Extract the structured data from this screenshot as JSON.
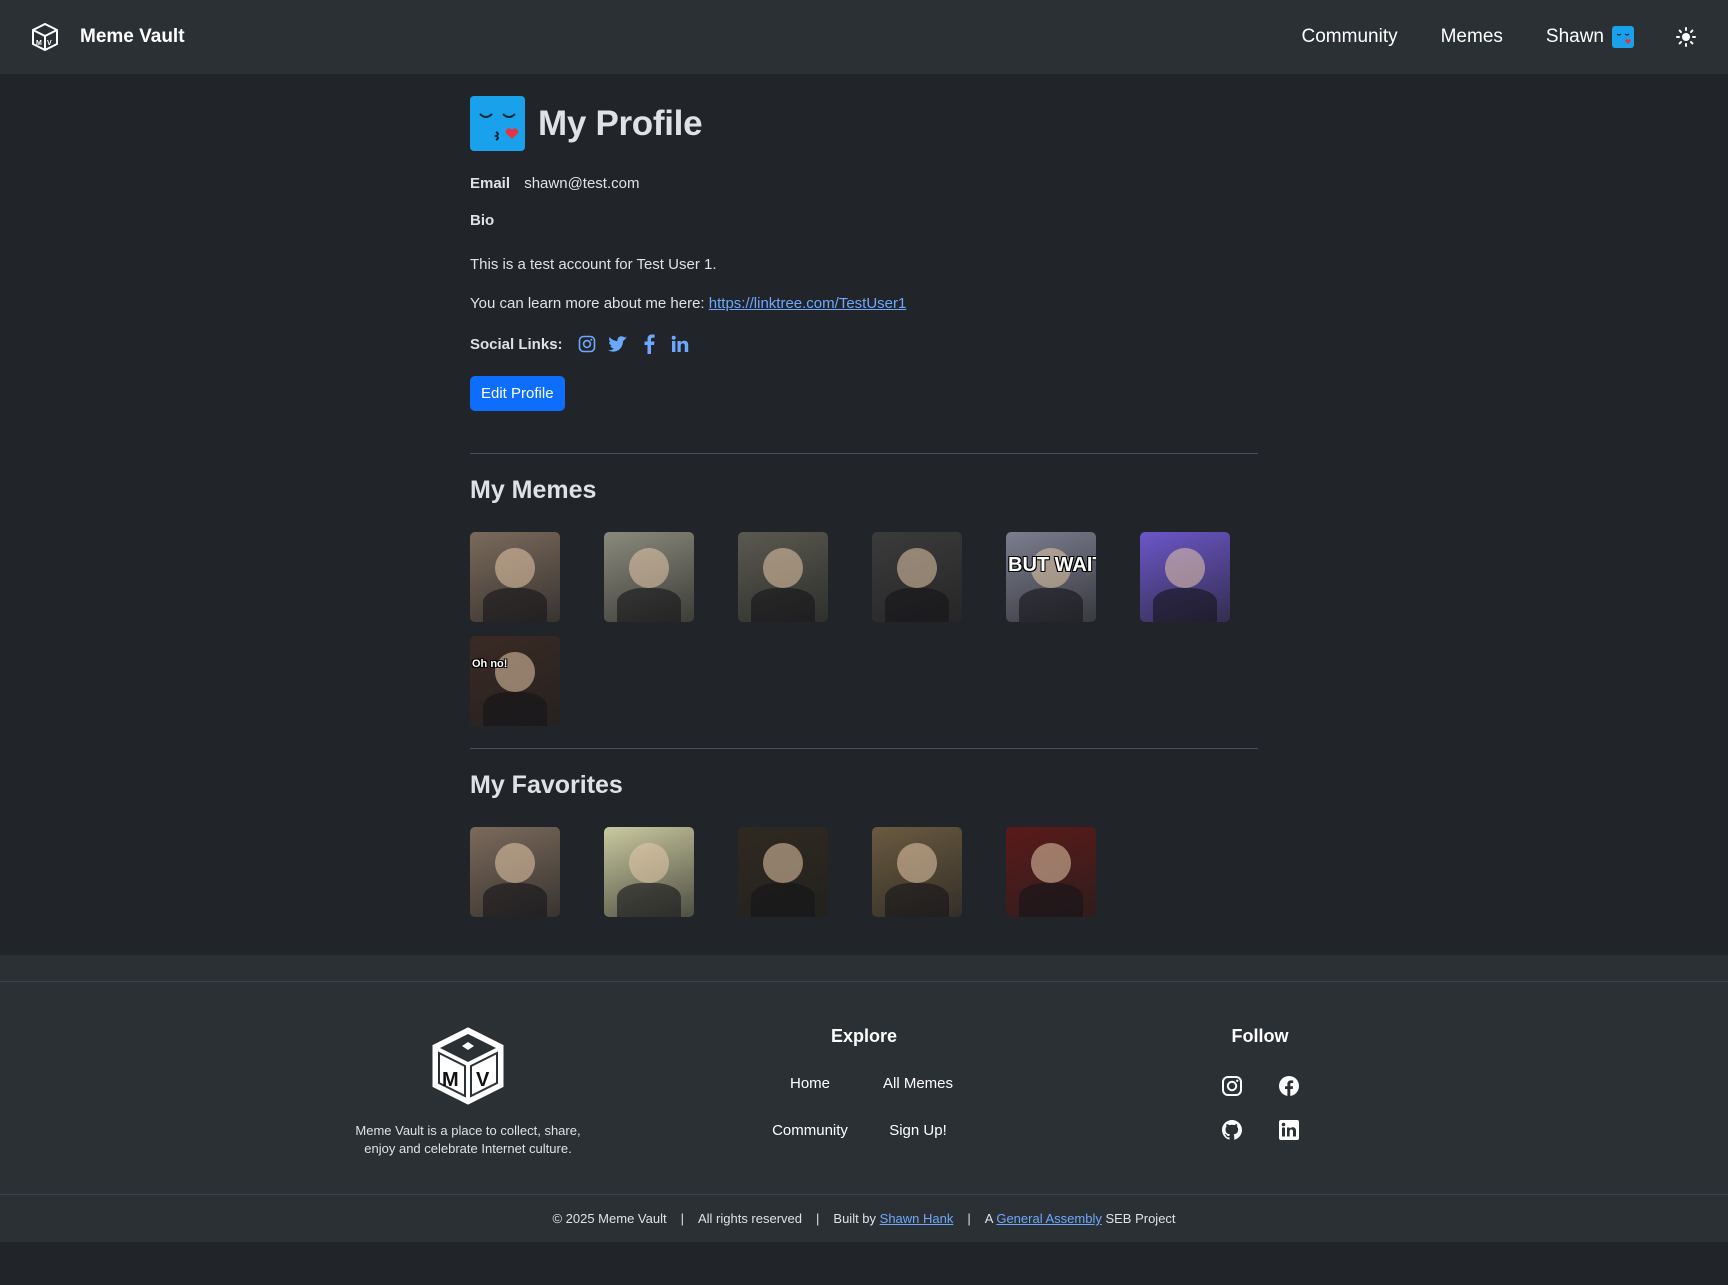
{
  "nav": {
    "brand": "Meme Vault",
    "links": [
      "Community",
      "Memes"
    ],
    "user": "Shawn",
    "icons": {
      "logo": "mv-cube-logo",
      "avatar": "kissing-face-avatar",
      "theme": "sun-icon"
    }
  },
  "profile": {
    "title": "My Profile",
    "email_label": "Email",
    "email": "shawn@test.com",
    "bio_label": "Bio",
    "bio_line1": "This is a test account for Test User 1.",
    "bio_line2_prefix": "You can learn more about me here: ",
    "bio_link": "https://linktree.com/TestUser1",
    "social_label": "Social Links:",
    "social_icons": [
      "instagram-icon",
      "twitter-icon",
      "facebook-icon",
      "linkedin-icon"
    ],
    "edit_button": "Edit Profile"
  },
  "my_memes": {
    "title": "My Memes",
    "items": [
      {
        "name": "rick-astley",
        "bg": "#7b6a5c"
      },
      {
        "name": "pole-cam",
        "bg": "#8a8a7c"
      },
      {
        "name": "dancing-man",
        "bg": "#5a5a50"
      },
      {
        "name": "bw-crowd",
        "bg": "#3b3b3b"
      },
      {
        "name": "but-wait",
        "bg": "#7c7e90",
        "caption": "BUT WAIT,"
      },
      {
        "name": "success-kid",
        "bg": "#6b56c9"
      },
      {
        "name": "oh-no",
        "bg": "#3a2a24",
        "caption": "Oh no!"
      }
    ]
  },
  "my_favorites": {
    "title": "My Favorites",
    "items": [
      {
        "name": "rick-astley",
        "bg": "#7b6a5c"
      },
      {
        "name": "this-is-fine",
        "bg": "#c9c9a0"
      },
      {
        "name": "snoop-dog",
        "bg": "#2f2a20"
      },
      {
        "name": "obama-mic-drop",
        "bg": "#6a5a40"
      },
      {
        "name": "muppet-hecklers",
        "bg": "#5b1a1a"
      }
    ]
  },
  "footer": {
    "description": "Meme Vault is a place to collect, share, enjoy and celebrate Internet culture.",
    "explore_heading": "Explore",
    "explore_links": [
      "Home",
      "All Memes",
      "Community",
      "Sign Up!"
    ],
    "follow_heading": "Follow",
    "follow_icons": [
      "instagram-icon",
      "facebook-icon",
      "github-icon",
      "linkedin-icon"
    ],
    "copyright": "© 2025 Meme Vault",
    "rights": "All rights reserved",
    "built_by_prefix": "Built by ",
    "built_by_name": "Shawn Hank",
    "project_prefix": "A ",
    "project_link": "General Assembly",
    "project_suffix": " SEB Project",
    "separator": "|"
  },
  "colors": {
    "page_bg": "#212529",
    "nav_bg": "#2b3035",
    "accent": "#0d6efd",
    "link": "#6ea8fe",
    "avatar_bg": "#1aa1ec"
  }
}
